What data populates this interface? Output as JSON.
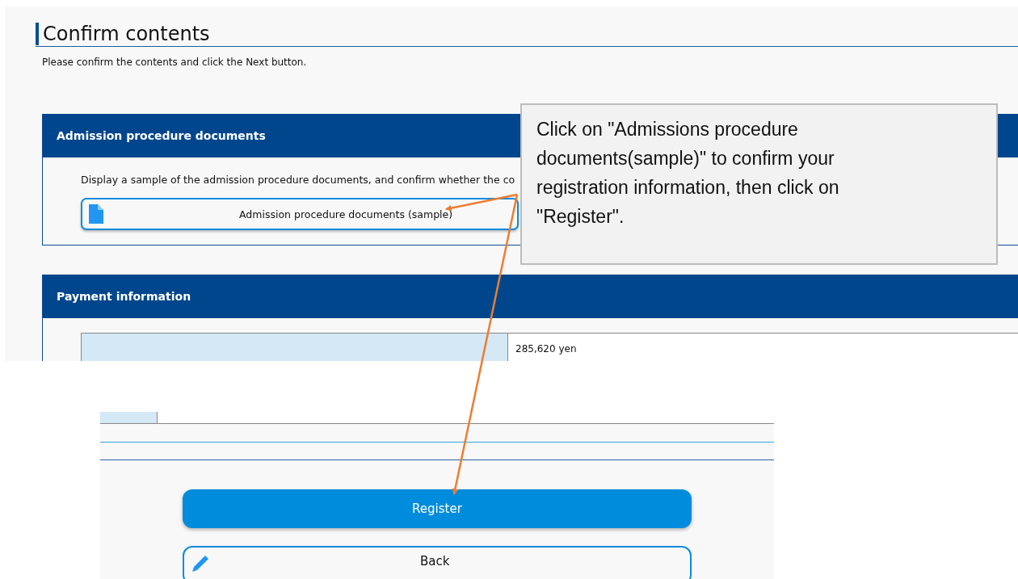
{
  "page": {
    "title": "Confirm contents",
    "instruction": "Please confirm the contents and click the Next button."
  },
  "sections": [
    {
      "kind": "documents",
      "title": "Admission procedure documents",
      "description": "Display a sample of the admission procedure documents, and confirm whether the co",
      "button": "Admission procedure documents (sample)"
    },
    {
      "kind": "payment",
      "title": "Payment information",
      "value": "285,620 yen"
    }
  ],
  "actions": [
    {
      "kind": "primary",
      "label": "Register"
    },
    {
      "kind": "secondary",
      "label": "Back"
    }
  ],
  "callout": {
    "text": "Click on \"Admissions procedure documents(sample)\" to confirm your registration information, then click on \"Register\"."
  }
}
